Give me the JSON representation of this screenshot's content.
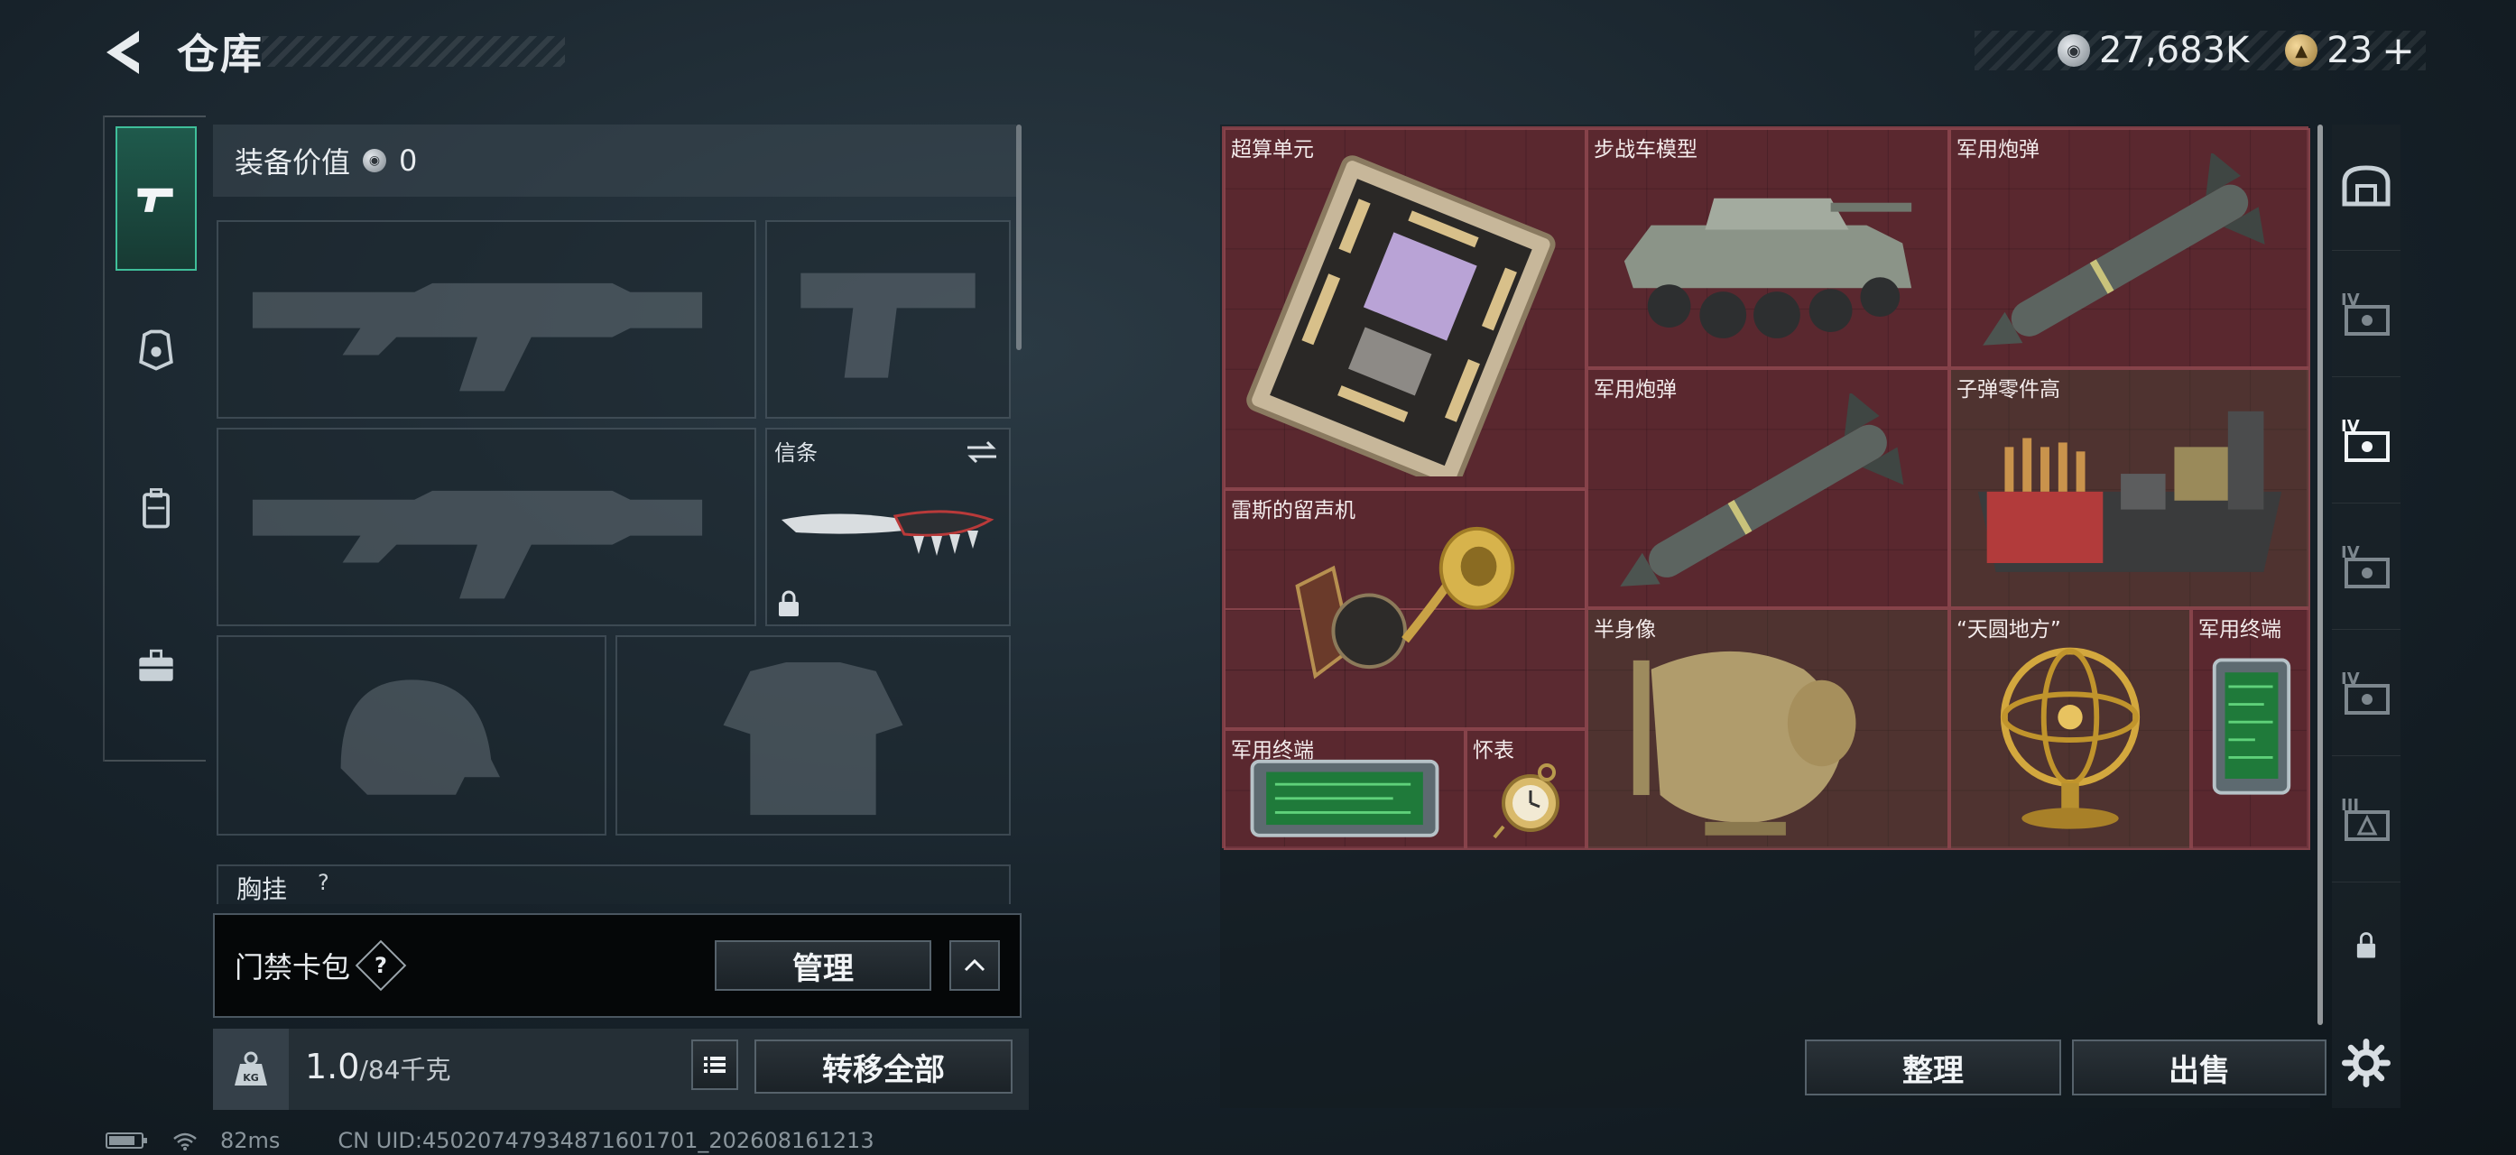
{
  "header": {
    "title": "仓库",
    "currency_silver": "27,683K",
    "currency_gold": "23",
    "gold_add": "+"
  },
  "left_tabs": [
    {
      "icon": "pistol-icon",
      "active": true
    },
    {
      "icon": "armor-icon",
      "active": false
    },
    {
      "icon": "backpack-icon",
      "active": false
    },
    {
      "icon": "briefcase-icon",
      "active": false
    }
  ],
  "equipment": {
    "value_label": "装备价值",
    "value": "0",
    "melee_label": "信条",
    "chest_label": "胸挂",
    "chest_q": "?"
  },
  "cardpack": {
    "label": "门禁卡包",
    "help": "?",
    "manage_button": "管理",
    "collapse": "^"
  },
  "bottom": {
    "weight_current": "1.0",
    "weight_max": "/84千克",
    "transfer_all_button": "转移全部",
    "sort_button": "整理",
    "sell_button": "出售"
  },
  "storage_items": [
    {
      "name": "超算单元"
    },
    {
      "name": "步战车模型"
    },
    {
      "name": "军用炮弹"
    },
    {
      "name": "军用炮弹"
    },
    {
      "name": "子弹零件高"
    },
    {
      "name": "雷斯的留声机"
    },
    {
      "name": "半身像"
    },
    {
      "name": "“天圆地方”"
    },
    {
      "name": "军用终端"
    },
    {
      "name": "军用终端"
    },
    {
      "name": "怀表"
    }
  ],
  "status": {
    "ping": "82ms",
    "uid": "CN UID:450207479348716017​01_202608161213"
  },
  "colors": {
    "accent": "#3fbf9a",
    "grid_bg": "#5b2a31",
    "gold_item_bg": "#46403a"
  }
}
